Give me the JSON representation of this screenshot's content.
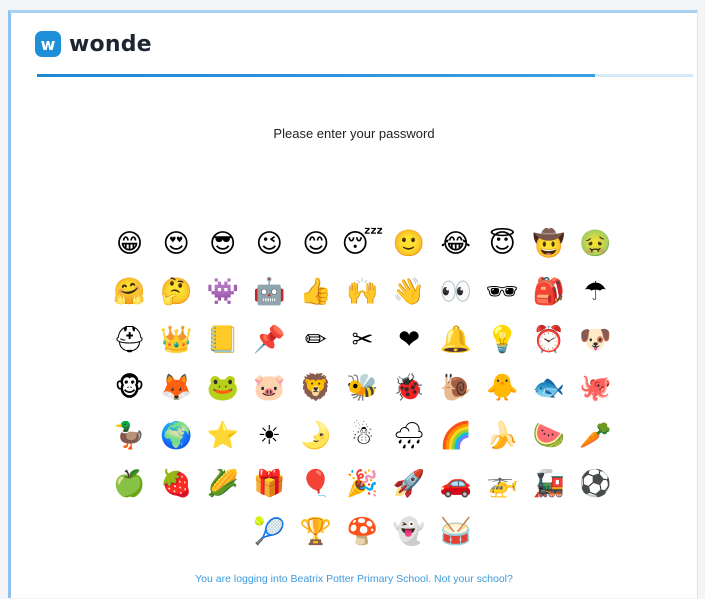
{
  "brand": {
    "logo_letter": "w",
    "name": "wonde",
    "color": "#1e90d8"
  },
  "login": {
    "prompt": "Please enter your password",
    "progress_fraction": 0.85
  },
  "emoji_grid": [
    {
      "name": "grinning-face",
      "glyph": "😁"
    },
    {
      "name": "heart-eyes-face",
      "glyph": "😍"
    },
    {
      "name": "sunglasses-face",
      "glyph": "😎"
    },
    {
      "name": "winking-face",
      "glyph": "😉"
    },
    {
      "name": "smiling-face",
      "glyph": "😊"
    },
    {
      "name": "sleeping-face",
      "glyph": "😴"
    },
    {
      "name": "neutral-face",
      "glyph": "🙂"
    },
    {
      "name": "crying-laughing-face",
      "glyph": "😂"
    },
    {
      "name": "halo-face",
      "glyph": "😇"
    },
    {
      "name": "cowboy-face",
      "glyph": "🤠"
    },
    {
      "name": "nauseated-face",
      "glyph": "🤢"
    },
    {
      "name": "hugging-face",
      "glyph": "🤗"
    },
    {
      "name": "thinking-face",
      "glyph": "🤔"
    },
    {
      "name": "alien-monster",
      "glyph": "👾"
    },
    {
      "name": "robot",
      "glyph": "🤖"
    },
    {
      "name": "thumbs-up",
      "glyph": "👍"
    },
    {
      "name": "raised-hands",
      "glyph": "🙌"
    },
    {
      "name": "waving-hand",
      "glyph": "👋"
    },
    {
      "name": "eyes",
      "glyph": "👀"
    },
    {
      "name": "dark-sunglasses",
      "glyph": "🕶"
    },
    {
      "name": "backpack",
      "glyph": "🎒"
    },
    {
      "name": "umbrella",
      "glyph": "☂"
    },
    {
      "name": "rescue-helmet",
      "glyph": "⛑"
    },
    {
      "name": "crown",
      "glyph": "👑"
    },
    {
      "name": "notebook",
      "glyph": "📒"
    },
    {
      "name": "pushpin",
      "glyph": "📌"
    },
    {
      "name": "pencil",
      "glyph": "✏"
    },
    {
      "name": "scissors",
      "glyph": "✂"
    },
    {
      "name": "heart",
      "glyph": "❤"
    },
    {
      "name": "bell",
      "glyph": "🔔"
    },
    {
      "name": "light-bulb",
      "glyph": "💡"
    },
    {
      "name": "alarm-clock",
      "glyph": "⏰"
    },
    {
      "name": "dog-face",
      "glyph": "🐶"
    },
    {
      "name": "monkey-face",
      "glyph": "🐵"
    },
    {
      "name": "fox-face",
      "glyph": "🦊"
    },
    {
      "name": "frog-face",
      "glyph": "🐸"
    },
    {
      "name": "pig-face",
      "glyph": "🐷"
    },
    {
      "name": "lion-face",
      "glyph": "🦁"
    },
    {
      "name": "honeybee",
      "glyph": "🐝"
    },
    {
      "name": "ladybug",
      "glyph": "🐞"
    },
    {
      "name": "snail",
      "glyph": "🐌"
    },
    {
      "name": "chick",
      "glyph": "🐥"
    },
    {
      "name": "fish",
      "glyph": "🐟"
    },
    {
      "name": "octopus",
      "glyph": "🐙"
    },
    {
      "name": "duck",
      "glyph": "🦆"
    },
    {
      "name": "globe",
      "glyph": "🌍"
    },
    {
      "name": "star",
      "glyph": "⭐"
    },
    {
      "name": "sun",
      "glyph": "☀"
    },
    {
      "name": "crescent-moon",
      "glyph": "🌛"
    },
    {
      "name": "snowman",
      "glyph": "☃"
    },
    {
      "name": "rain-cloud",
      "glyph": "🌧"
    },
    {
      "name": "rainbow",
      "glyph": "🌈"
    },
    {
      "name": "banana",
      "glyph": "🍌"
    },
    {
      "name": "watermelon",
      "glyph": "🍉"
    },
    {
      "name": "carrot",
      "glyph": "🥕"
    },
    {
      "name": "green-apple",
      "glyph": "🍏"
    },
    {
      "name": "strawberry",
      "glyph": "🍓"
    },
    {
      "name": "corn",
      "glyph": "🌽"
    },
    {
      "name": "gift",
      "glyph": "🎁"
    },
    {
      "name": "balloon",
      "glyph": "🎈"
    },
    {
      "name": "party-popper",
      "glyph": "🎉"
    },
    {
      "name": "rocket",
      "glyph": "🚀"
    },
    {
      "name": "car",
      "glyph": "🚗"
    },
    {
      "name": "helicopter",
      "glyph": "🚁"
    },
    {
      "name": "locomotive",
      "glyph": "🚂"
    },
    {
      "name": "soccer-ball",
      "glyph": "⚽"
    },
    {
      "name": "tennis-ball",
      "glyph": "🎾"
    },
    {
      "name": "trophy",
      "glyph": "🏆"
    },
    {
      "name": "mushroom",
      "glyph": "🍄"
    },
    {
      "name": "ghost",
      "glyph": "👻"
    },
    {
      "name": "drum",
      "glyph": "🥁"
    }
  ],
  "footer": {
    "text": "You are logging into Beatrix Potter Primary School. Not your school?"
  },
  "colors": {
    "accent": "#1e88d3",
    "link": "#3c9be0",
    "frame": "#8fc3ee"
  }
}
